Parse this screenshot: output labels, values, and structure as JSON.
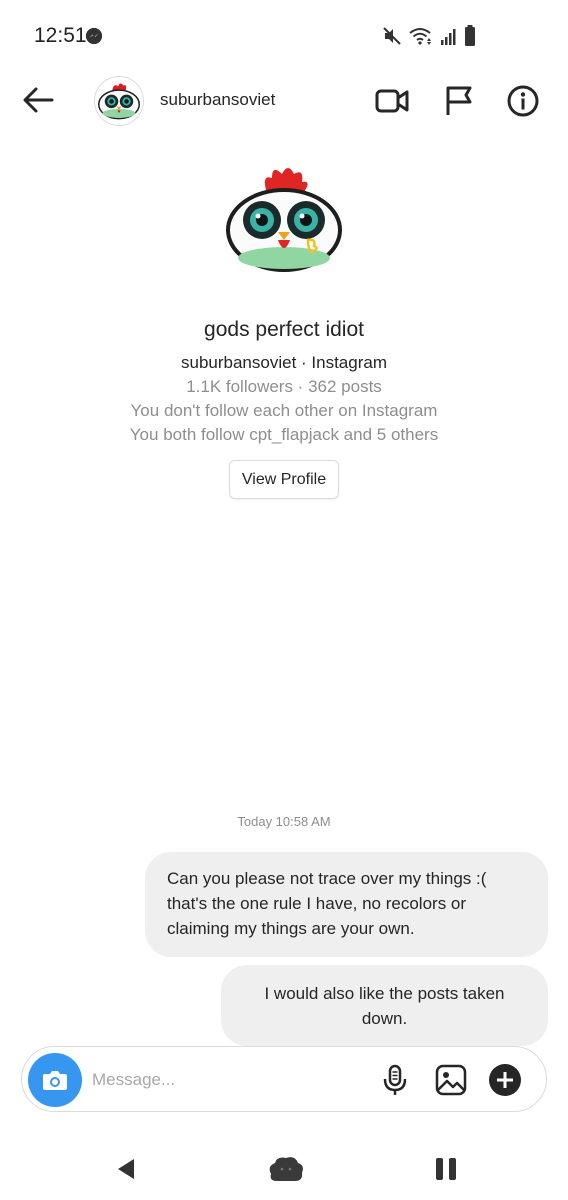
{
  "status_bar": {
    "time": "12:51"
  },
  "header": {
    "username": "suburbansoviet"
  },
  "profile": {
    "full_name": "gods perfect idiot",
    "handle_line": "suburbansoviet · Instagram",
    "stats_line": "1.1K followers · 362 posts",
    "follow_status": "You don't follow each other on Instagram",
    "mutuals_line": "You both follow cpt_flapjack and 5 others",
    "view_profile_label": "View Profile"
  },
  "conversation": {
    "timestamp": "Today 10:58 AM",
    "messages": [
      {
        "text": "Can you please not trace over my things :( that's the one rule I have, no recolors or claiming my things are your own."
      },
      {
        "text": "I would also like the posts taken down."
      }
    ]
  },
  "composer": {
    "placeholder": "Message..."
  },
  "icons": {
    "back": "arrow-left-icon",
    "video": "video-camera-icon",
    "flag": "flag-icon",
    "info": "info-icon",
    "camera": "camera-icon",
    "mic": "microphone-icon",
    "gallery": "image-icon",
    "plus": "plus-circle-icon"
  },
  "colors": {
    "accent": "#3797f0",
    "bubble": "#efefef",
    "secondary_text": "#8e8e8e"
  }
}
